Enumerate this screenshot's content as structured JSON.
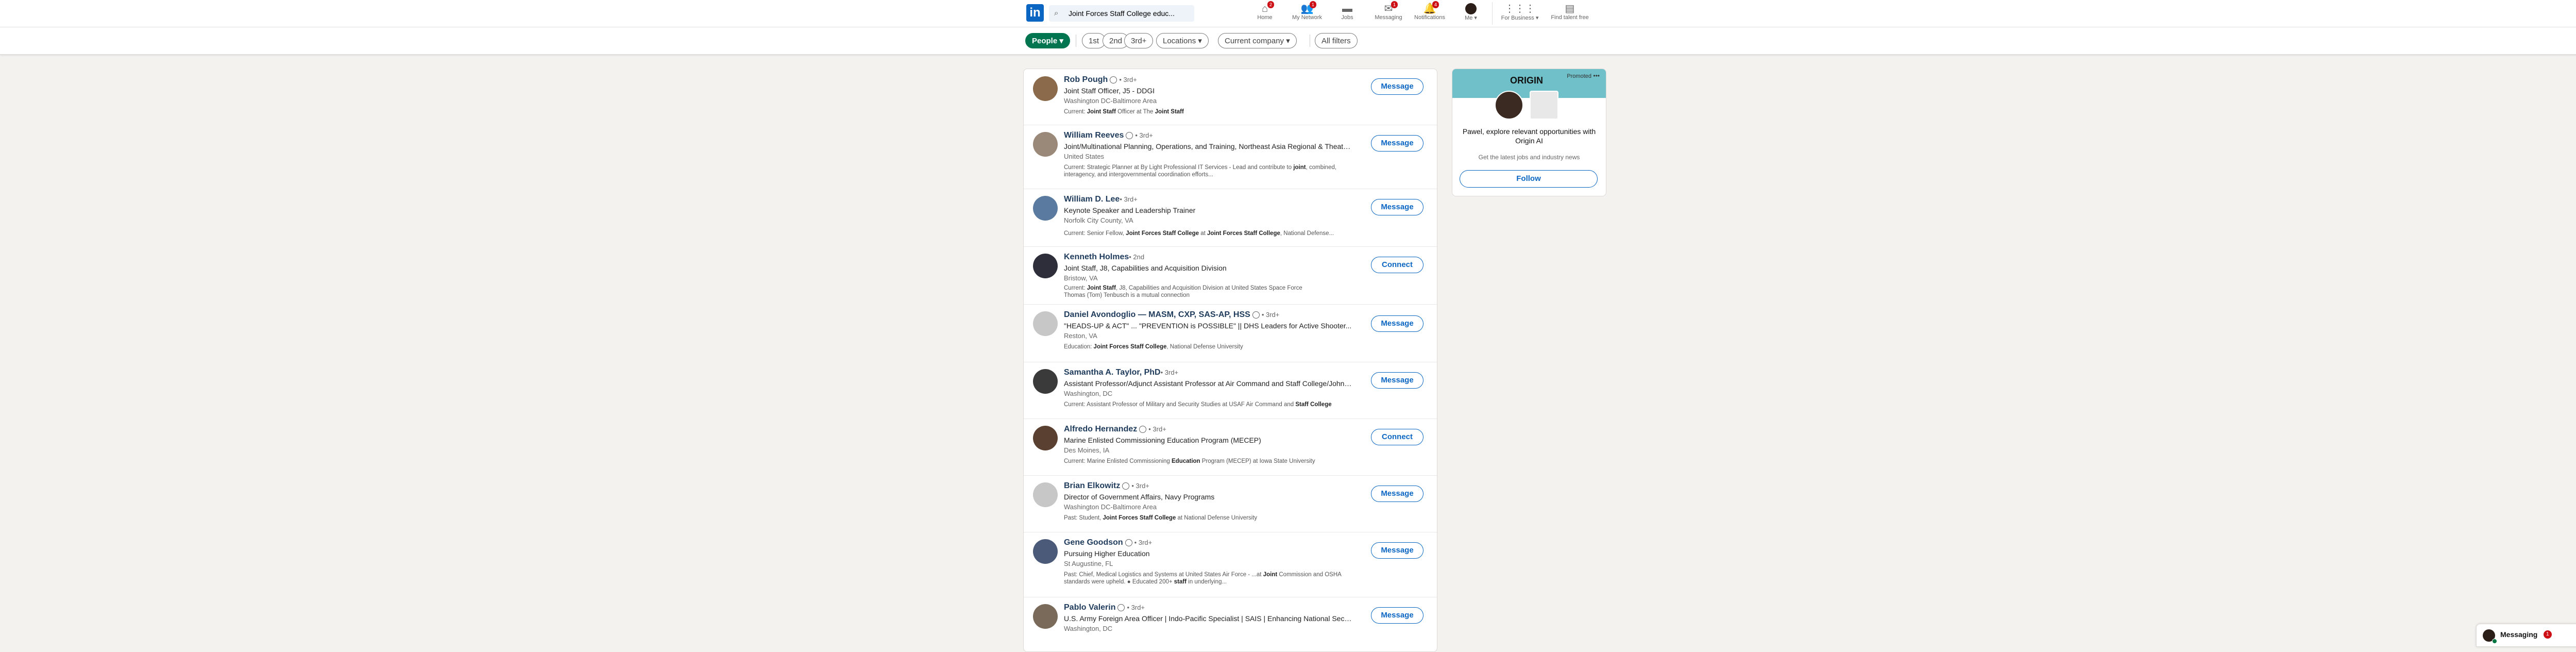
{
  "nav": {
    "logo_text": "in",
    "search_value": "Joint Forces Staff College educ...",
    "items": [
      {
        "label": "Home",
        "icon": "home-icon",
        "badge": "2"
      },
      {
        "label": "My Network",
        "icon": "network-icon",
        "badge": "1"
      },
      {
        "label": "Jobs",
        "icon": "jobs-icon",
        "badge": ""
      },
      {
        "label": "Messaging",
        "icon": "messaging-icon",
        "badge": "1"
      },
      {
        "label": "Notifications",
        "icon": "bell-icon",
        "badge": "4"
      }
    ],
    "me_label": "Me ▾",
    "business_label": "For Business ▾",
    "talent_label": "Find talent free"
  },
  "filters": {
    "people": "People ▾",
    "first": "1st",
    "second": "2nd",
    "third": "3rd+",
    "locations": "Locations ▾",
    "current_company": "Current company ▾",
    "all_filters": "All filters"
  },
  "results": [
    {
      "name": "Rob Pough",
      "verified": true,
      "degree": "• 3rd+",
      "headline": "Joint Staff Officer, J5 - DDGI",
      "location": "Washington DC-Baltimore Area",
      "summary_html": "Current: <b>Joint Staff</b> Officer at The <b>Joint Staff</b>",
      "action": "Message"
    },
    {
      "name": "William Reeves",
      "verified": true,
      "degree": "• 3rd+",
      "headline": "Joint/Multinational Planning, Operations, and Training, Northeast Asia Regional & Theater...",
      "location": "United States",
      "summary_html": "Current: Strategic Planner at By Light Professional IT Services - Lead and contribute to <b>joint</b>, combined, interagency, and intergovernmental coordination efforts...",
      "action": "Message"
    },
    {
      "name": "William D. Lee",
      "verified": false,
      "degree": "• 3rd+",
      "headline": "Keynote Speaker and Leadership Trainer",
      "location": "Norfolk City County, VA",
      "summary_html": "Current: Senior Fellow, <b>Joint Forces Staff College</b> at <b>Joint Forces Staff College</b>, National Defense...",
      "action": "Message"
    },
    {
      "name": "Kenneth Holmes",
      "verified": false,
      "degree": "• 2nd",
      "headline": "Joint Staff, J8, Capabilities and Acquisition Division",
      "location": "Bristow, VA",
      "summary_html": "Current: <b>Joint Staff</b>, J8, Capabilities and Acquisition Division at United States Space Force<br>Thomas (Tom) Tenbusch is a mutual connection",
      "action": "Connect"
    },
    {
      "name": "Daniel Avondoglio — MASM, CXP, SAS-AP, HSS",
      "verified": true,
      "degree": "• 3rd+",
      "headline": "\"HEADS-UP & ACT\" ... \"PREVENTION is POSSIBLE\" || DHS Leaders for Active Shooter...",
      "location": "Reston, VA",
      "summary_html": "Education: <b>Joint Forces Staff College</b>, National Defense University",
      "action": "Message"
    },
    {
      "name": "Samantha A. Taylor, PhD",
      "verified": false,
      "degree": "• 3rd+",
      "headline": "Assistant Professor/Adjunct Assistant Professor at Air Command and Staff College/Johns...",
      "location": "Washington, DC",
      "summary_html": "Current: Assistant Professor of Military and Security Studies at USAF Air Command and <b>Staff College</b>",
      "action": "Message"
    },
    {
      "name": "Alfredo Hernandez",
      "verified": true,
      "degree": "• 3rd+",
      "headline": "Marine Enlisted Commissioning Education Program (MECEP)",
      "location": "Des Moines, IA",
      "summary_html": "Current: Marine Enlisted Commissioning <b>Education</b> Program (MECEP) at Iowa State University",
      "action": "Connect"
    },
    {
      "name": "Brian Elkowitz",
      "verified": true,
      "degree": "• 3rd+",
      "headline": "Director of Government Affairs, Navy Programs",
      "location": "Washington DC-Baltimore Area",
      "summary_html": "Past: Student, <b>Joint Forces Staff College</b> at National Defense University",
      "action": "Message"
    },
    {
      "name": "Gene Goodson",
      "verified": true,
      "degree": "• 3rd+",
      "headline": "Pursuing Higher Education",
      "location": "St Augustine, FL",
      "summary_html": "Past: Chief, Medical Logistics and Systems at United States Air Force - ...at <b>Joint</b> Commission and OSHA standards were upheld. ● Educated 200+ <b>staff</b> in underlying...",
      "action": "Message"
    },
    {
      "name": "Pablo Valerin",
      "verified": true,
      "degree": "• 3rd+",
      "headline": "U.S. Army Foreign Area Officer | Indo-Pacific Specialist | SAIS | Enhancing National Security...",
      "location": "Washington, DC",
      "summary_html": "",
      "action": "Message"
    }
  ],
  "ad": {
    "brand": "ORIGIN",
    "promoted": "Promoted",
    "dots": "•••",
    "message": "Pawel, explore relevant opportunities with Origin AI",
    "sub": "Get the latest jobs and industry news",
    "follow": "Follow"
  },
  "messaging": {
    "title": "Messaging",
    "badge": "1",
    "ctrl_more": "•••",
    "ctrl_compose": "✎",
    "ctrl_expand": "⌃"
  },
  "colors": {
    "accent": "#0a66c2",
    "people_pill": "#01754f",
    "badge": "#cc1016"
  }
}
